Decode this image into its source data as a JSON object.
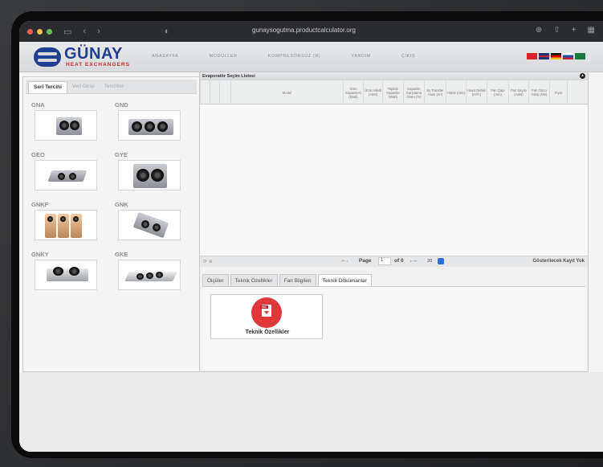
{
  "browser": {
    "url": "gunaysogutma.productcalculator.org"
  },
  "brand": {
    "name": "GÜNAY",
    "tagline": "HEAT EXCHANGERS"
  },
  "nav": [
    "ANASAYFA",
    "MODÜLLER",
    "KOMPRESÖRSÜZ (R)",
    "YARDIM",
    "ÇIKIŞ"
  ],
  "flags": [
    {
      "name": "turkey",
      "colors": [
        "#d8232a",
        "#d8232a"
      ]
    },
    {
      "name": "uk",
      "colors": [
        "#24347a",
        "#c8202f"
      ]
    },
    {
      "name": "germany",
      "colors": [
        "#111111",
        "#f2c200"
      ]
    },
    {
      "name": "russia",
      "colors": [
        "#ffffff",
        "#c8202f"
      ]
    },
    {
      "name": "saudi",
      "colors": [
        "#167a3a",
        "#167a3a"
      ]
    }
  ],
  "left_panel": {
    "tabs": [
      "Seri Tercihi",
      "Veri Girişi",
      "Tercihler"
    ],
    "series": [
      {
        "name": "GNA"
      },
      {
        "name": "GND"
      },
      {
        "name": "GEO"
      },
      {
        "name": "GYE"
      },
      {
        "name": "GNKF"
      },
      {
        "name": "GNK"
      },
      {
        "name": "GNKY"
      },
      {
        "name": "GKE"
      }
    ]
  },
  "grid": {
    "title": "Evaporatör Seçim Listesi",
    "columns": [
      "Model",
      "Ürün Kapasitesi (Watt)",
      "Ürün Adedi (Adet)",
      "Toplam Kapasite (Watt)",
      "Kapasite Karşılama Oranı (%)",
      "Isı Transfer Alanı (m²)",
      "Hatve (mm)",
      "Hava Debisi (m³/h)",
      "Fan Çapı (mm)",
      "Fan Sayısı (Adet)",
      "Fan Gücü Girişi (kW)",
      "Fiyat"
    ],
    "pager": {
      "page_label": "Page",
      "page": "1",
      "of_label": "of 0",
      "page_size": "20",
      "status": "Gösterilecek Kayıt Yok"
    }
  },
  "detail_tabs": [
    "Ölçüler",
    "Teknik Özellikler",
    "Fan Bilgileri",
    "Teknik Dökümanlar"
  ],
  "documents": [
    {
      "label": "Teknik Özellikler",
      "icon": "pdf-icon",
      "tag": "PDF"
    }
  ]
}
